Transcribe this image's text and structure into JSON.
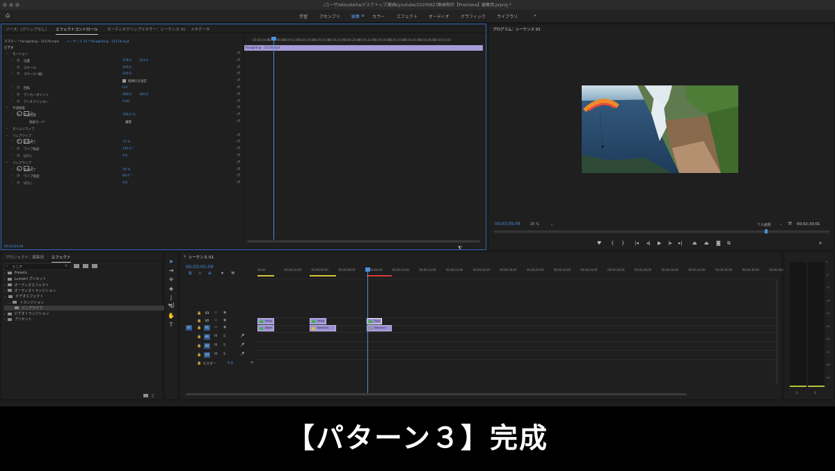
{
  "window": {
    "title": "/ユーザ/ebisukeita/デスクトップ/動画/youtube/20200627動画制作【Premiere】編集用.prproj *"
  },
  "topnav": {
    "items": [
      "学習",
      "アセンブリ",
      "編集",
      "カラー",
      "エフェクト",
      "オーディオ",
      "グラフィック",
      "ライブラリ"
    ],
    "more": "»",
    "active_index": 2
  },
  "effect_controls": {
    "tabs": [
      "ソース：(クリップなし)",
      "エフェクトコントロール",
      "オーディオクリップミキサー：シーケンス 01",
      "メタデータ"
    ],
    "master_label": "マスター * Paragliding - 31178.mp4",
    "sequence_label": "シーケンス 01 * Paragliding - 31178.mp4",
    "section_video": "ビデオ",
    "rows": [
      {
        "label": "モーション"
      },
      {
        "label": "位置",
        "v1": "378.0",
        "v2": "253.0"
      },
      {
        "label": "スケール",
        "v1": "100.0"
      },
      {
        "label": "スケール (幅)",
        "v1": "100.0"
      },
      {
        "label": "縦横比を固定"
      },
      {
        "label": "回転",
        "v1": "0.0"
      },
      {
        "label": "アンカーポイント",
        "v1": "960.0",
        "v2": "540.0"
      },
      {
        "label": "アンチフリッカー",
        "v1": "0.00"
      },
      {
        "label": "不透明度"
      },
      {
        "label": "不透明度",
        "v1": "100.0 %"
      },
      {
        "label": "描画モード",
        "v1": "通常"
      },
      {
        "label": "タイムリマップ"
      },
      {
        "label": "リニアワイプ"
      },
      {
        "label": "変換終了",
        "v1": "31 %"
      },
      {
        "label": "ワイプ角度",
        "v1": "120.0 °"
      },
      {
        "label": "ぼかし",
        "v1": "0.0"
      },
      {
        "label": "リニアワイプ"
      },
      {
        "label": "変換終了",
        "v1": "34 %"
      },
      {
        "label": "ワイプ角度",
        "v1": "60.0 °"
      },
      {
        "label": "ぼかし",
        "v1": "0.0"
      }
    ],
    "timecode": "00;03;05;09",
    "ruler": [
      "00;00;04;00",
      "00;00;08;00",
      "00;00;12;00",
      "00;00;16;00",
      "00;00;20;00",
      "00;00;24;00",
      "00;00;28;00",
      "00;00;32;00",
      "00;00;36;00",
      "00;00;40;00",
      "00;00;44;00",
      "00;00;48;00",
      "00;00;52;00"
    ],
    "clip_label": "Paragliding - 31178.mp4"
  },
  "program": {
    "title": "プログラム：シーケンス 01",
    "timecode": "00;03;05;09",
    "zoom": "25 %",
    "quality": "フル画質",
    "duration": "00;02;33;01"
  },
  "effects_panel": {
    "tabs": [
      "プロジェクト：編集用",
      "エフェクト"
    ],
    "search": "リニア",
    "tree": [
      {
        "label": "Presets",
        "level": 0
      },
      {
        "label": "Lumetri プリセット",
        "level": 0
      },
      {
        "label": "オーディオエフェクト",
        "level": 0
      },
      {
        "label": "オーディオトランジション",
        "level": 0
      },
      {
        "label": "ビデオエフェクト",
        "level": 0
      },
      {
        "label": "トランジション",
        "level": 1
      },
      {
        "label": "リニアワイプ",
        "level": 2
      },
      {
        "label": "ビデオトランジション",
        "level": 0
      },
      {
        "label": "プリセット",
        "level": 0
      }
    ]
  },
  "timeline": {
    "tab": "シーケンス 01",
    "timecode": "00;03;05;09",
    "ruler": [
      "00;00",
      "00;00;02;00",
      "00;00;04;00",
      "00;00;06;00",
      "00;00;08;00",
      "00;00;10;00",
      "00;00;12;00",
      "00;00;14;00",
      "00;00;16;00",
      "00;00;18;00",
      "00;00;20;00",
      "00;00;22;00",
      "00;00;24;00",
      "00;00;26;00",
      "00;00;28;00",
      "00;00;30;00",
      "00;00;32;00",
      "00;00;34;00",
      "00;00;36;00",
      "00;00;38;00"
    ],
    "tracks": [
      {
        "name": "V3"
      },
      {
        "name": "V2"
      },
      {
        "name": "V1",
        "src": "V1"
      },
      {
        "name": "A1"
      },
      {
        "name": "A2"
      },
      {
        "name": "A3"
      }
    ],
    "master": "マスター",
    "master_val": "0.0",
    "clip_labels": [
      "Parag",
      "Water",
      "Parag",
      "Waterfall",
      "Para",
      "Waterfall"
    ]
  },
  "meter": {
    "scale": [
      "0",
      "-6",
      "-12",
      "-18",
      "-24",
      "-30",
      "-36",
      "-42",
      "-48",
      "-54"
    ],
    "bottom": [
      "S",
      "S"
    ]
  },
  "caption": "【パターン３】完成"
}
